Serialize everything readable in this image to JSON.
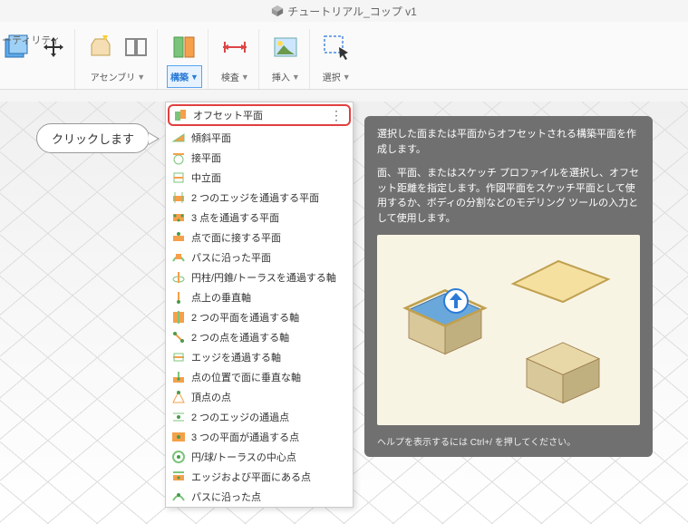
{
  "titlebar": {
    "title": "チュートリアル_コップ v1"
  },
  "utilities_label": "ーティリティ",
  "toolbar": {
    "assembly_label": "アセンブリ",
    "construct_label": "構築",
    "inspect_label": "検査",
    "insert_label": "挿入",
    "select_label": "選択"
  },
  "callout": {
    "text": "クリックします"
  },
  "menu": {
    "items": [
      {
        "label": "オフセット平面",
        "highlighted": true
      },
      {
        "label": "傾斜平面"
      },
      {
        "label": "接平面"
      },
      {
        "label": "中立面"
      },
      {
        "label": "2 つのエッジを通過する平面"
      },
      {
        "label": "3 点を通過する平面"
      },
      {
        "label": "点で面に接する平面"
      },
      {
        "label": "パスに沿った平面"
      },
      {
        "label": "円柱/円錐/トーラスを通過する軸"
      },
      {
        "label": "点上の垂直軸"
      },
      {
        "label": "2 つの平面を通過する軸"
      },
      {
        "label": "2 つの点を通過する軸"
      },
      {
        "label": "エッジを通過する軸"
      },
      {
        "label": "点の位置で面に垂直な軸"
      },
      {
        "label": "頂点の点"
      },
      {
        "label": "2 つのエッジの通過点"
      },
      {
        "label": "3 つの平面が通過する点"
      },
      {
        "label": "円/球/トーラスの中心点"
      },
      {
        "label": "エッジおよび平面にある点"
      },
      {
        "label": "パスに沿った点"
      }
    ]
  },
  "tooltip": {
    "p1": "選択した面または平面からオフセットされる構築平面を作成します。",
    "p2": "面、平面、またはスケッチ プロファイルを選択し、オフセット距離を指定します。作図平面をスケッチ平面として使用するか、ボディの分割などのモデリング ツールの入力として使用します。",
    "footer": "ヘルプを表示するには Ctrl+/ を押してください。"
  }
}
